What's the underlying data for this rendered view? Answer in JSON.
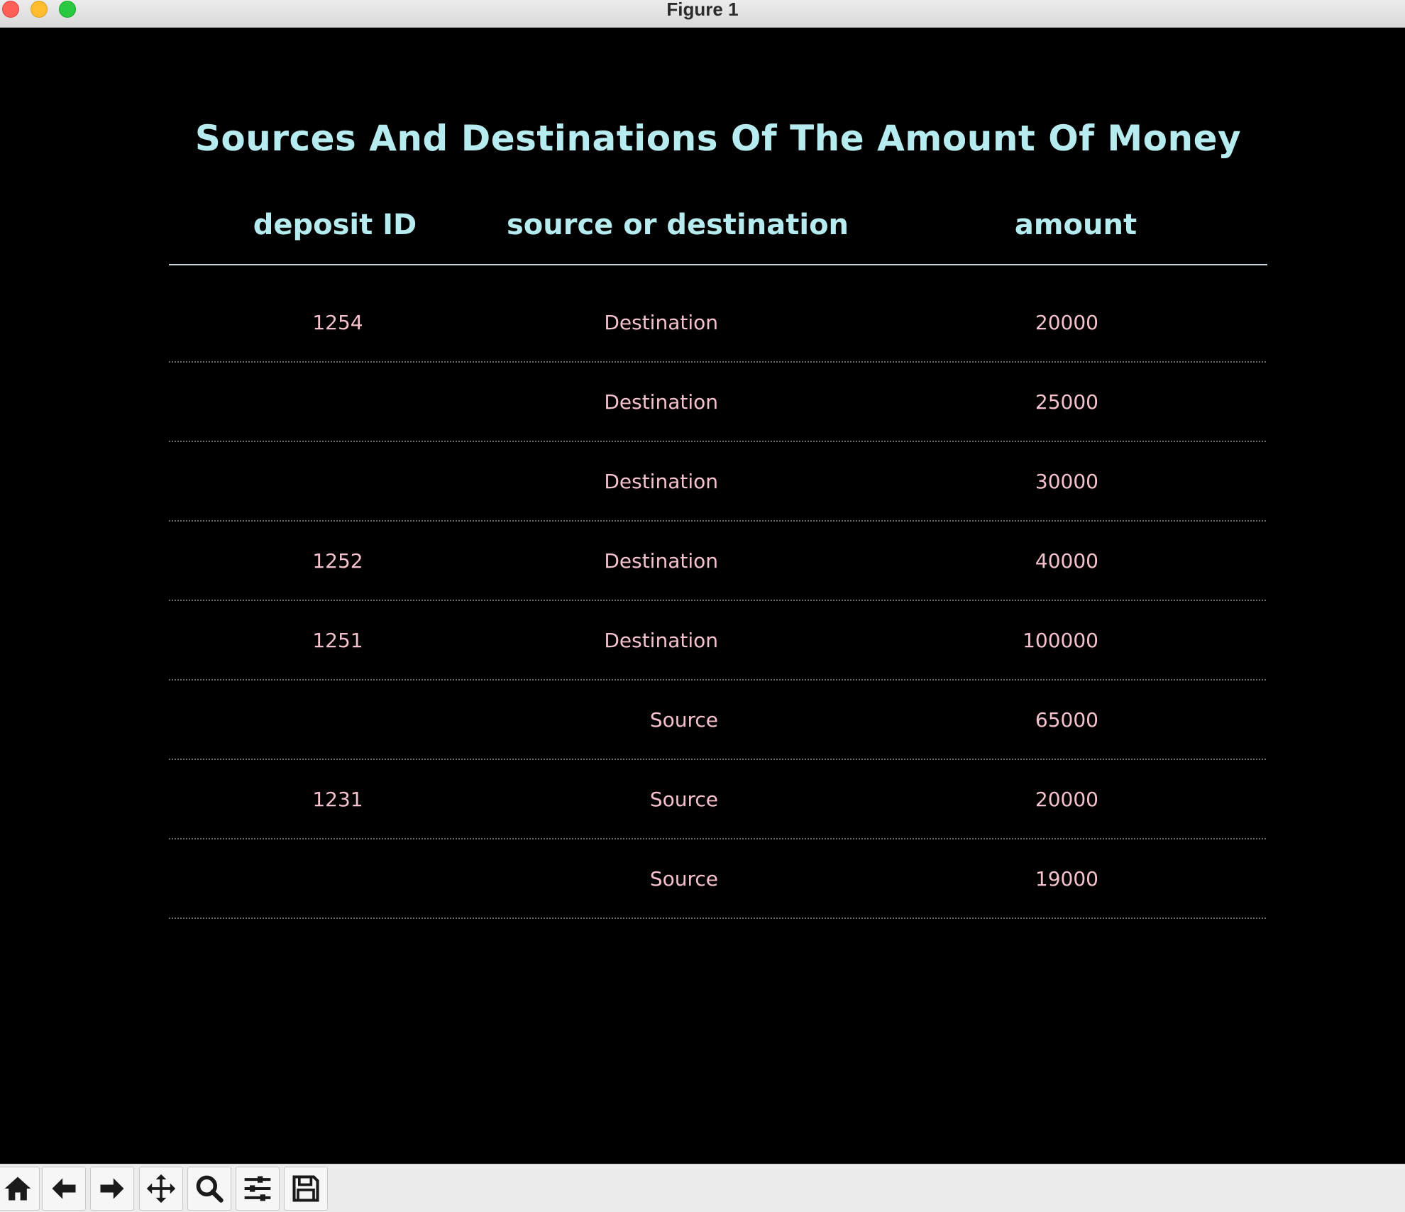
{
  "window": {
    "title": "Figure 1"
  },
  "colors": {
    "accent": "#b6ecef",
    "cell_text": "#f4c1cc",
    "background": "#000000",
    "rule": "#8a8a8a"
  },
  "chart_data": {
    "type": "table",
    "title": "Sources And Destinations Of The Amount Of Money",
    "columns": [
      "deposit ID",
      "source or destination",
      "amount"
    ],
    "rows": [
      [
        "1254",
        "Destination",
        "20000"
      ],
      [
        "",
        "Destination",
        "25000"
      ],
      [
        "",
        "Destination",
        "30000"
      ],
      [
        "1252",
        "Destination",
        "40000"
      ],
      [
        "1251",
        "Destination",
        "100000"
      ],
      [
        "",
        "Source",
        "65000"
      ],
      [
        "1231",
        "Source",
        "20000"
      ],
      [
        "",
        "Source",
        "19000"
      ]
    ]
  },
  "toolbar": {
    "buttons": [
      {
        "name": "home-button",
        "icon": "home-icon"
      },
      {
        "name": "back-button",
        "icon": "arrow-left-icon"
      },
      {
        "name": "forward-button",
        "icon": "arrow-right-icon"
      },
      {
        "name": "pan-button",
        "icon": "move-icon"
      },
      {
        "name": "zoom-button",
        "icon": "magnifier-icon"
      },
      {
        "name": "configure-subplots-button",
        "icon": "sliders-icon"
      },
      {
        "name": "save-button",
        "icon": "floppy-disk-icon"
      }
    ]
  }
}
